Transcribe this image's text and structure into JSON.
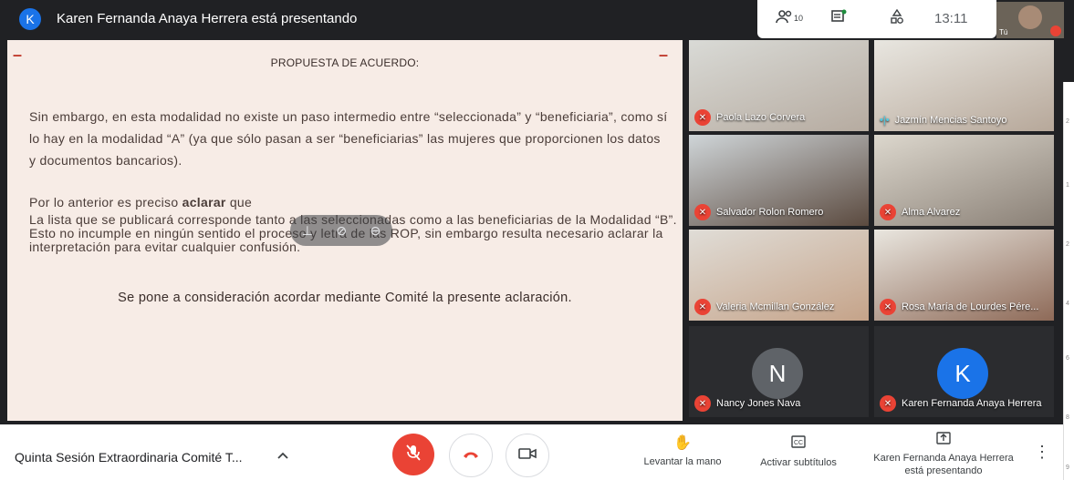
{
  "header": {
    "presenter_initial": "K",
    "presenting_text": "Karen Fernanda Anaya Herrera está presentando",
    "participant_count": "10",
    "clock": "13:11",
    "self_label": "Tú"
  },
  "slide": {
    "title": "PROPUESTA DE ACUERDO:",
    "p1": "Sin embargo, en esta modalidad no existe un paso intermedio entre “seleccionada” y “beneficiaria”, como sí lo hay en la modalidad “A” (ya que sólo pasan a ser “beneficiarias” las mujeres que proporcionen los datos y documentos bancarios).",
    "p2_prefix": "Por lo anterior es preciso ",
    "p2_bold": "aclarar",
    "p2_suffix": " que",
    "p3": "La lista que se publicará corresponde tanto a las seleccionadas como a las beneficiarias de la Modalidad “B”. Esto no incumple en ningún sentido el proceso y letra de las ROP, sin embargo resulta necesario aclarar la interpretación para evitar cualquier confusión.",
    "p4": "Se pone a consideración acordar mediante Comité la presente aclaración."
  },
  "participants": [
    {
      "name": "Paola Lazo Corvera",
      "status": "muted"
    },
    {
      "name": "Jazmín Mencias Santoyo",
      "status": "speaking"
    },
    {
      "name": "Salvador Rolon Romero",
      "status": "muted"
    },
    {
      "name": "Alma Alvarez",
      "status": "muted"
    },
    {
      "name": "Valeria Mcmillan González",
      "status": "muted"
    },
    {
      "name": "Rosa María de Lourdes Pére...",
      "status": "muted"
    },
    {
      "name": "Nancy Jones Nava",
      "status": "muted",
      "initial": "N",
      "avatar_color": "#5f6368"
    },
    {
      "name": "Karen Fernanda Anaya Herrera",
      "status": "muted",
      "initial": "K",
      "avatar_color": "#1a73e8"
    }
  ],
  "footer": {
    "meeting_title": "Quinta Sesión Extraordinaria Comité T...",
    "raise_hand": "Levantar la mano",
    "captions": "Activar subtítulos",
    "presenting_line1": "Karen Fernanda Anaya Herrera",
    "presenting_line2": "está presentando"
  },
  "colors": {
    "end_call": "#ea4335",
    "mic_off": "#ea4335",
    "accent": "#1a73e8"
  }
}
